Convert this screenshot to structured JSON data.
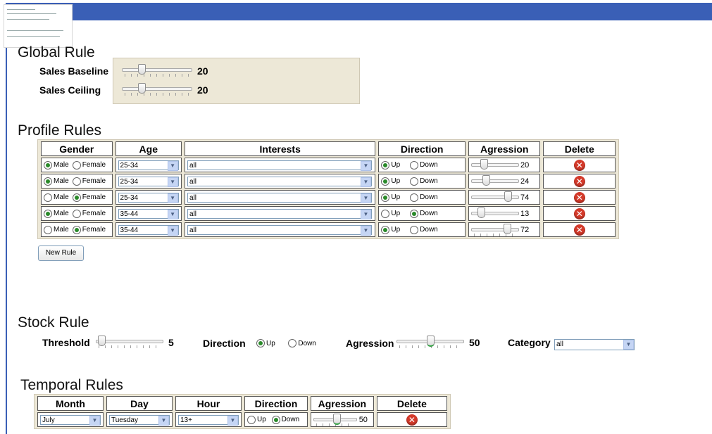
{
  "colors": {
    "topbar": "#3a5fb6",
    "panel": "#ede8d7",
    "accent_radio": "#2a8a2a",
    "delete": "#d43a2a"
  },
  "global_rule": {
    "title": "Global Rule",
    "sales_baseline": {
      "label": "Sales Baseline",
      "value": "20"
    },
    "sales_ceiling": {
      "label": "Sales Ceiling",
      "value": "20"
    }
  },
  "profile_rules": {
    "title": "Profile Rules",
    "headers": [
      "Gender",
      "Age",
      "Interests",
      "Direction",
      "Agression",
      "Delete"
    ],
    "gender_options": [
      "Male",
      "Female"
    ],
    "direction_options": [
      "Up",
      "Down"
    ],
    "rows": [
      {
        "gender": "Male",
        "age": "25-34",
        "interests": "all",
        "direction": "Up",
        "agression": "20"
      },
      {
        "gender": "Male",
        "age": "25-34",
        "interests": "all",
        "direction": "Up",
        "agression": "24"
      },
      {
        "gender": "Female",
        "age": "25-34",
        "interests": "all",
        "direction": "Up",
        "agression": "74"
      },
      {
        "gender": "Male",
        "age": "35-44",
        "interests": "all",
        "direction": "Down",
        "agression": "13"
      },
      {
        "gender": "Female",
        "age": "35-44",
        "interests": "all",
        "direction": "Up",
        "agression": "72"
      }
    ],
    "new_rule_label": "New Rule"
  },
  "stock_rule": {
    "title": "Stock Rule",
    "threshold_label": "Threshold",
    "threshold_value": "5",
    "direction_label": "Direction",
    "direction_options": [
      "Up",
      "Down"
    ],
    "direction_selected": "Up",
    "agression_label": "Agression",
    "agression_value": "50",
    "category_label": "Category",
    "category_value": "all"
  },
  "temporal_rules": {
    "title": "Temporal Rules",
    "headers": [
      "Month",
      "Day",
      "Hour",
      "Direction",
      "Agression",
      "Delete"
    ],
    "row": {
      "month": "July",
      "day": "Tuesday",
      "hour": "13+",
      "direction": "Down",
      "agression": "50"
    },
    "direction_options": [
      "Up",
      "Down"
    ]
  },
  "icons": {
    "delete": "delete-x-icon",
    "dropdown": "chevron-down-icon"
  }
}
